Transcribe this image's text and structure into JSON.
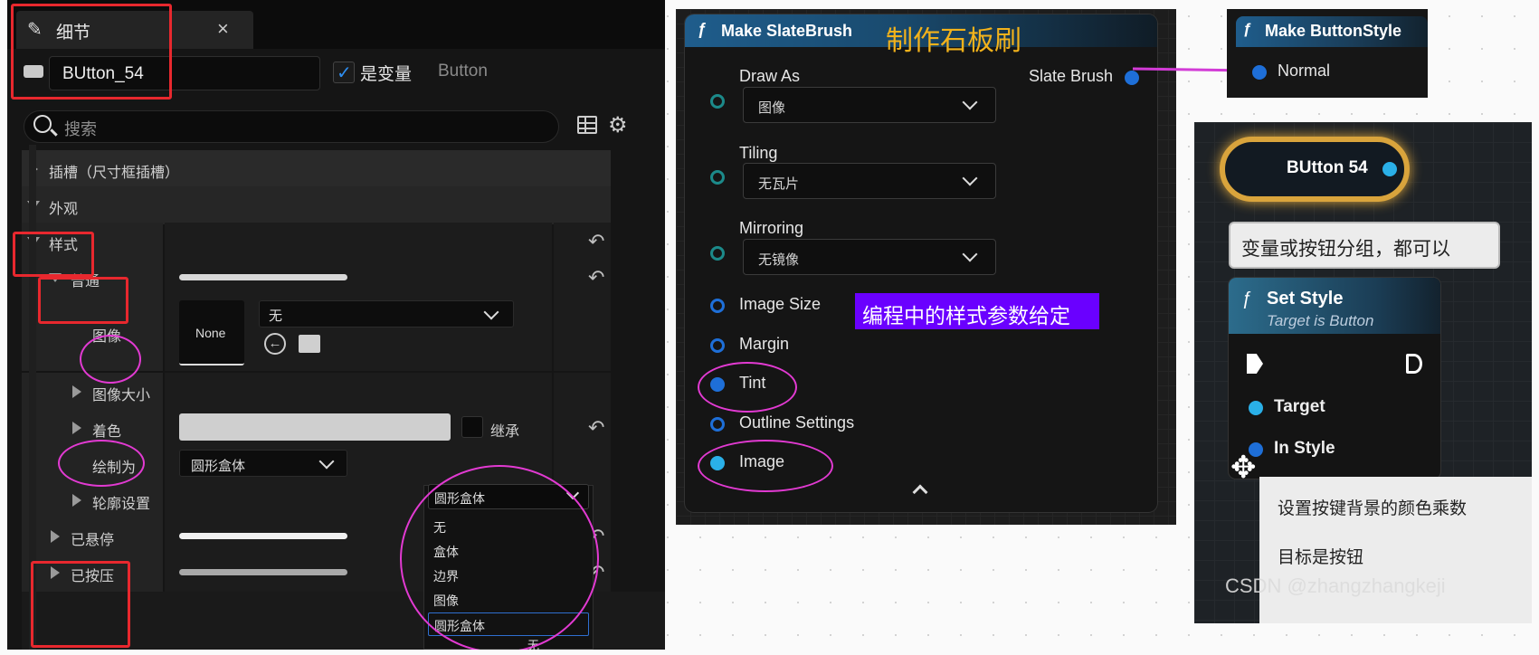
{
  "details": {
    "tab_title": "细节",
    "widget_name": "BUtton_54",
    "is_variable_label": "是变量",
    "type_label": "Button",
    "search_placeholder": "搜索",
    "rows": {
      "slot": "插槽（尺寸框插槽）",
      "appearance": "外观",
      "style": "样式",
      "normal": "普通",
      "image": "图像",
      "image_none": "None",
      "image_dropdown": "无",
      "image_size": "图像大小",
      "tint": "着色",
      "inherit": "继承",
      "draw_as": "绘制为",
      "draw_as_value": "圆形盒体",
      "outline": "轮廓设置",
      "hovered": "已悬停",
      "pressed": "已按压"
    },
    "dropdown": {
      "selected": "圆形盒体",
      "options": [
        "无",
        "盒体",
        "边界",
        "图像",
        "圆形盒体"
      ],
      "cut_off": "无"
    }
  },
  "graph": {
    "node_title": "Make SlateBrush",
    "annotation": "制作石板刷",
    "pins": {
      "draw_as": "Draw As",
      "draw_as_value": "图像",
      "tiling": "Tiling",
      "tiling_value": "无瓦片",
      "mirroring": "Mirroring",
      "mirroring_value": "无镜像",
      "image_size": "Image Size",
      "margin": "Margin",
      "tint": "Tint",
      "outline": "Outline Settings",
      "image": "Image",
      "output": "Slate Brush"
    },
    "banner": "编程中的样式参数给定"
  },
  "button_style_node": {
    "title": "Make ButtonStyle",
    "pin": "Normal"
  },
  "photo": {
    "var_node": "BUtton 54",
    "comment": "变量或按钮分组，都可以",
    "func_title": "Set Style",
    "func_sub": "Target is Button",
    "target": "Target",
    "in_style": "In Style",
    "tooltip_line1": "设置按键背景的颜色乘数",
    "tooltip_line2": "目标是按钮",
    "watermark": "CSDN @zhangzhangkeji"
  },
  "colors": {
    "accent": "#1e6fd8",
    "annotation_red": "#e8282e",
    "annotation_pink": "#e23ad2",
    "banner_bg": "#6a00ff",
    "title_yellow": "#f2b21b"
  }
}
